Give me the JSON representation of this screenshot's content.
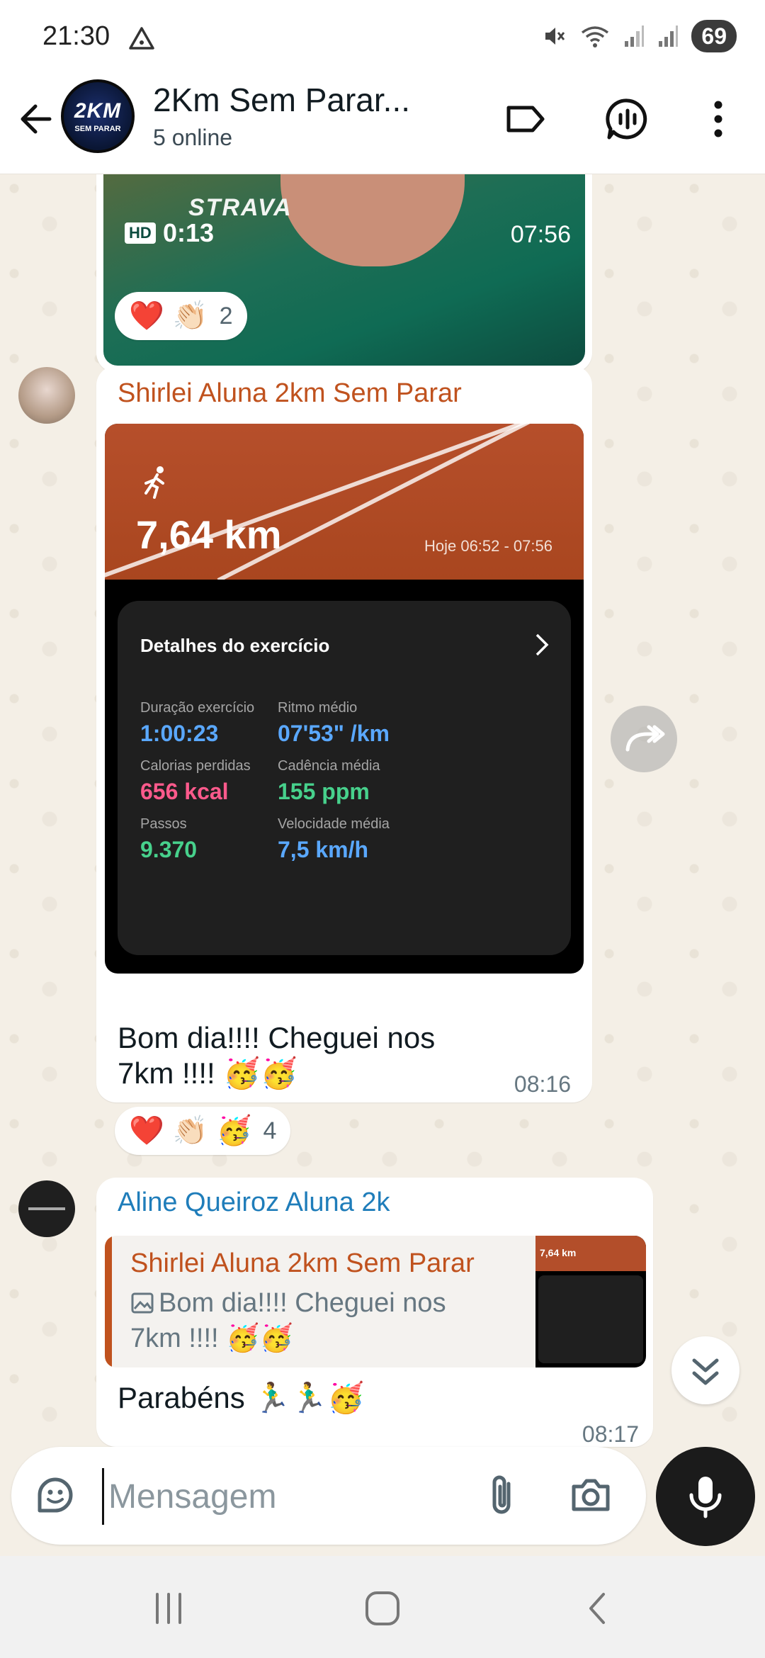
{
  "status_bar": {
    "time": "21:30",
    "battery": "69"
  },
  "header": {
    "title": "2Km Sem Parar...",
    "subtitle": "5 online",
    "avatar_line1": "2KM",
    "avatar_line2": "SEM PARAR"
  },
  "messages": {
    "video": {
      "watermark": "STRAVA",
      "hd_label": "HD",
      "duration": "0:13",
      "time": "07:56",
      "reactions": {
        "heart": "❤️",
        "clap": "👏🏻",
        "count": "2"
      }
    },
    "shirlei": {
      "sender": "Shirlei Aluna 2km Sem Parar",
      "run_image": {
        "distance": "7,64 km",
        "date_range": "Hoje 06:52 - 07:56",
        "card_title": "Detalhes do exercício",
        "metrics": [
          {
            "label": "Duração exercício",
            "value": "1:00:23",
            "color": "#5aa8ff"
          },
          {
            "label": "Ritmo médio",
            "value": "07'53\" /km",
            "color": "#5aa8ff"
          },
          {
            "label": "Calorias perdidas",
            "value": "656 kcal",
            "color": "#ff5a8c"
          },
          {
            "label": "Cadência média",
            "value": "155 ppm",
            "color": "#47d18c"
          },
          {
            "label": "Passos",
            "value": "9.370",
            "color": "#47d18c"
          },
          {
            "label": "Velocidade média",
            "value": "7,5 km/h",
            "color": "#5aa8ff"
          }
        ]
      },
      "text_line1": "Bom dia!!!! Cheguei nos",
      "text_line2": "7km !!!! 🥳🥳",
      "time": "08:16",
      "reactions": {
        "heart": "❤️",
        "clap": "👏🏻",
        "party": "🥳",
        "count": "4"
      }
    },
    "aline": {
      "sender": "Aline Queiroz Aluna 2k",
      "quote_author": "Shirlei Aluna 2km Sem Parar",
      "quote_text_line1": "Bom dia!!!! Cheguei nos",
      "quote_text_line2": "7km !!!! 🥳🥳",
      "quote_thumb_km": "7,64 km",
      "text": "Parabéns 🏃‍♂️🏃‍♂️🥳",
      "time": "08:17"
    }
  },
  "input": {
    "placeholder": "Mensagem"
  },
  "colors": {
    "accent_sender_1": "#c0521e",
    "accent_sender_2": "#1f7dba",
    "chat_bg": "#f4efe6"
  }
}
